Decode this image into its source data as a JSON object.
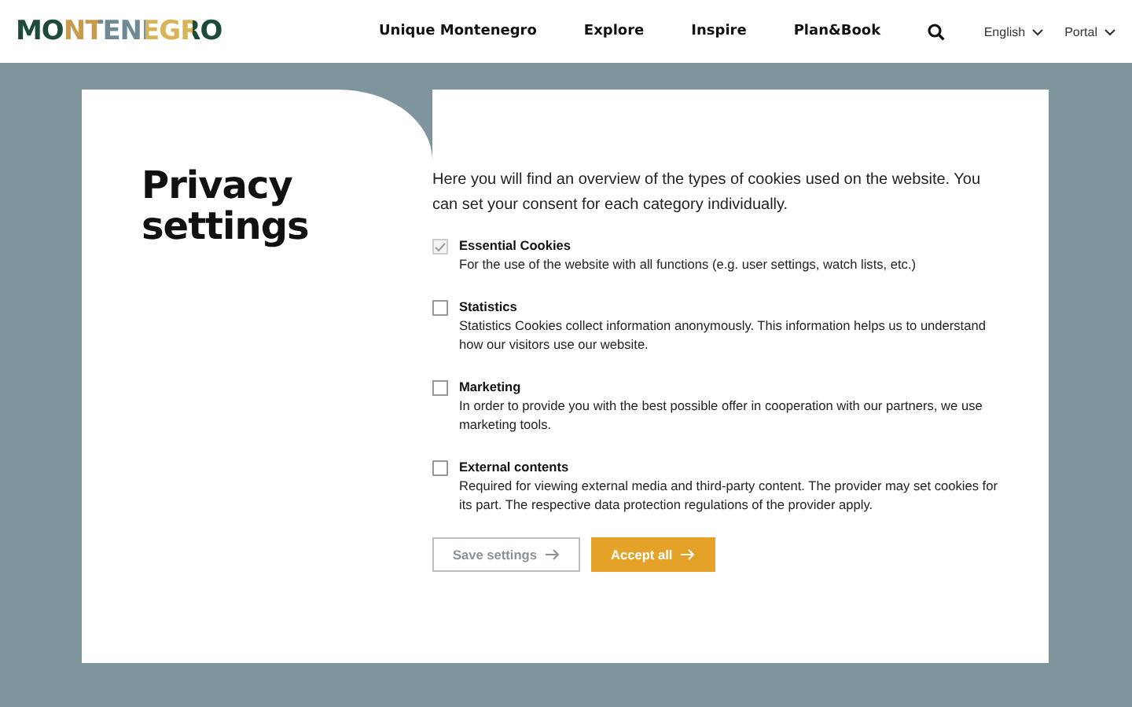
{
  "header": {
    "logo": "MONTENEGRO",
    "nav": [
      "Unique Montenegro",
      "Explore",
      "Inspire",
      "Plan&Book"
    ],
    "language": "English",
    "portal": "Portal"
  },
  "privacy": {
    "title": "Privacy settings",
    "intro": "Here you will find an overview of the types of cookies used on the website. You can set your consent for each category individually.",
    "categories": [
      {
        "name": "Essential Cookies",
        "description": "For the use of the website with all functions (e.g. user settings, watch lists, etc.)",
        "checked": true,
        "disabled": true
      },
      {
        "name": "Statistics",
        "description": "Statistics Cookies collect information anonymously. This information helps us to understand how our visitors use our website.",
        "checked": false,
        "disabled": false
      },
      {
        "name": "Marketing",
        "description": "In order to provide you with the best possible offer in cooperation with our partners, we use marketing tools.",
        "checked": false,
        "disabled": false
      },
      {
        "name": "External contents",
        "description": "Required for viewing external media and third-party content. The provider may set cookies for its part. The respective data protection regulations of the provider apply.",
        "checked": false,
        "disabled": false
      }
    ],
    "buttons": [
      {
        "label": "Save settings",
        "kind": "secondary"
      },
      {
        "label": "Accept all",
        "kind": "primary"
      }
    ]
  }
}
